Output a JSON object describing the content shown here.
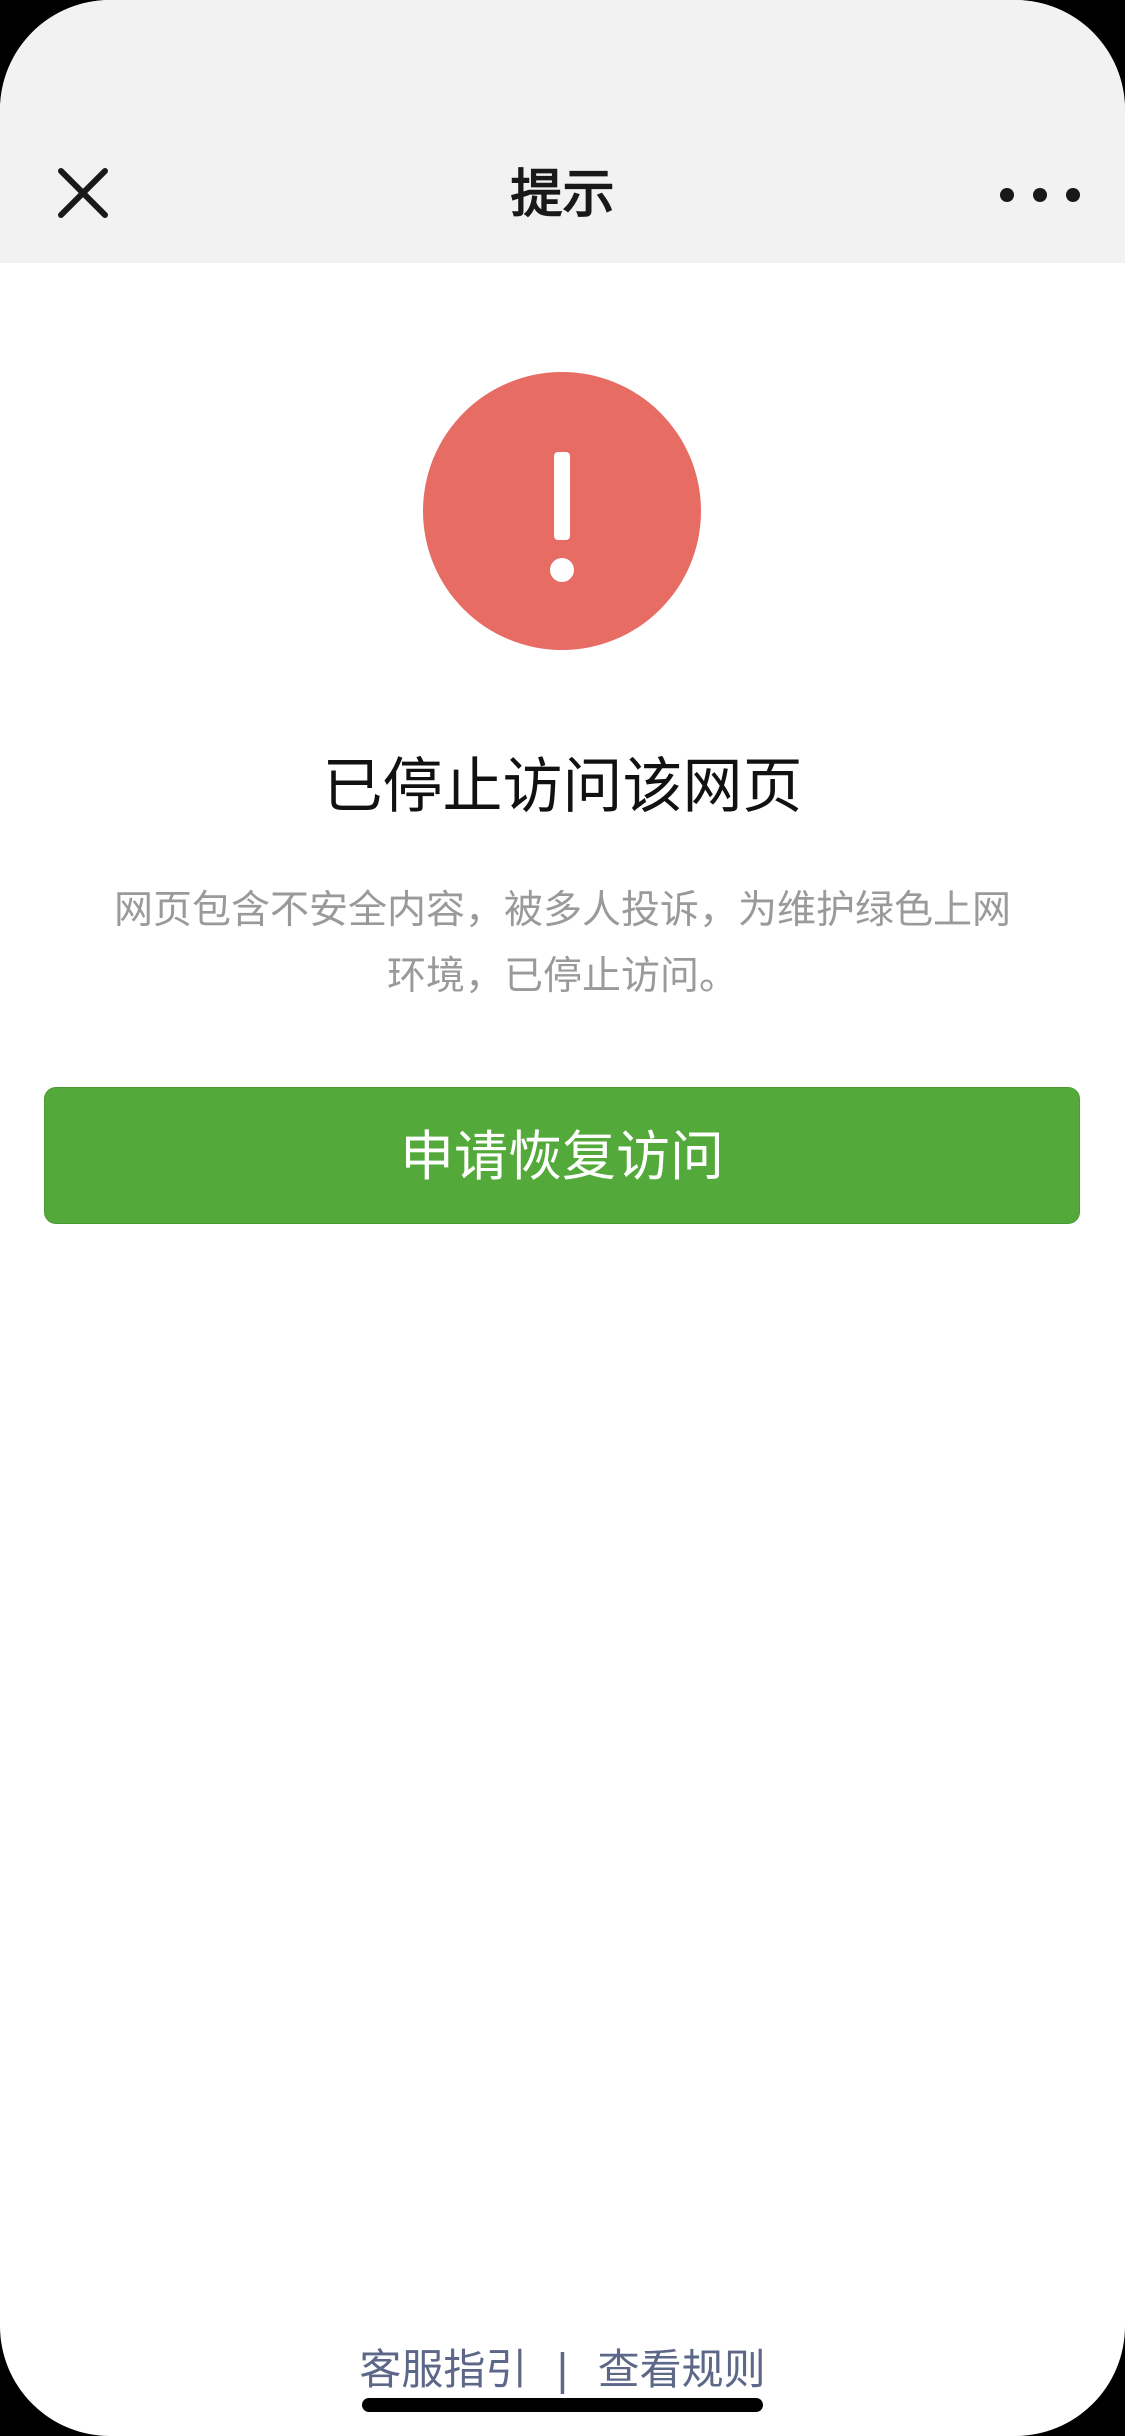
{
  "navbar": {
    "title": "提示",
    "close_icon": "close-icon",
    "more_icon": "more-icon"
  },
  "alert": {
    "icon": "exclamation-icon",
    "icon_color": "#e66c64",
    "title": "已停止访问该网页",
    "description_line1": "网页包含不安全内容，被多人投诉，为维护绿色上网",
    "description_line2": "环境，已停止访问。"
  },
  "actions": {
    "restore_label": "申请恢复访问",
    "restore_color": "#53aa3a"
  },
  "footer": {
    "service_guide": "客服指引",
    "separator": "|",
    "view_rules": "查看规则"
  }
}
